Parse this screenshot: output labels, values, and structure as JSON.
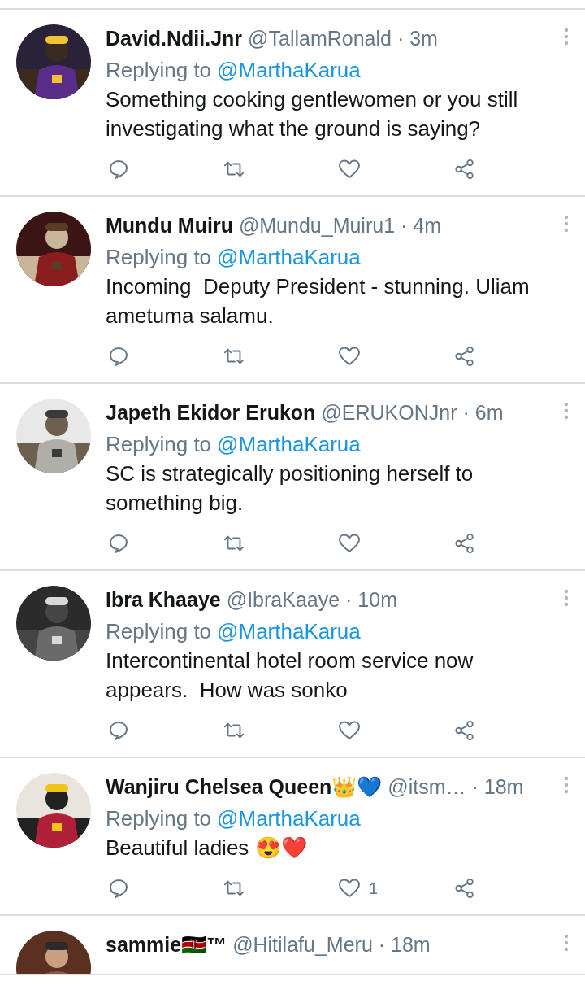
{
  "tweets": [
    {
      "name": "David.Ndii.Jnr",
      "handle": "@TallamRonald",
      "time": "· 3m",
      "replying_label": "Replying to",
      "replying_to": "@MarthaKarua",
      "body": "Something cooking gentlewomen or you still investigating what the ground is saying?"
    },
    {
      "name": "Mundu Muiru",
      "handle": "@Mundu_Muiru1",
      "time": "· 4m",
      "replying_label": "Replying to",
      "replying_to": "@MarthaKarua",
      "body": "Incoming  Deputy President - stunning. Uliam ametuma salamu."
    },
    {
      "name": "Japeth Ekidor Erukon",
      "handle": "@ERUKONJnr",
      "time": "· 6m",
      "replying_label": "Replying to",
      "replying_to": "@MarthaKarua",
      "body": "SC is strategically positioning herself to something big."
    },
    {
      "name": "Ibra Khaaye",
      "handle": "@IbraKaaye",
      "time": "· 10m",
      "replying_label": "Replying to",
      "replying_to": "@MarthaKarua",
      "body": "Intercontinental hotel room service now appears.  How was sonko"
    },
    {
      "name": "Wanjiru Chelsea Queen👑💙",
      "handle": "@itsm…",
      "time": "· 18m",
      "replying_label": "Replying to",
      "replying_to": "@MarthaKarua",
      "body": "Beautiful ladies 😍❤️",
      "likes": "1"
    },
    {
      "name": "sammie🇰🇪™",
      "handle": "@Hitilafu_Meru",
      "time": "· 18m"
    }
  ]
}
